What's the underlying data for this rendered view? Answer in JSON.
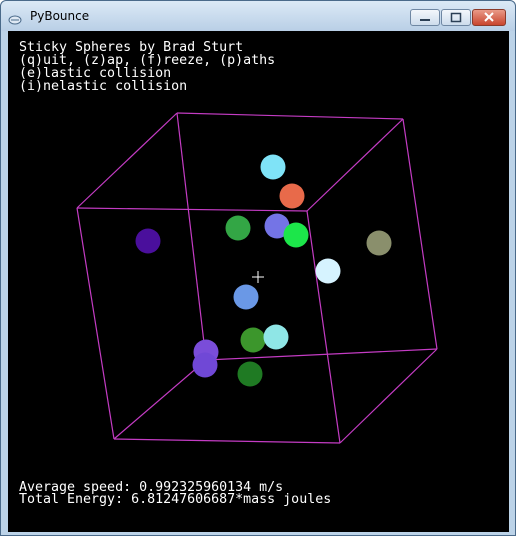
{
  "window": {
    "title": "PyBounce",
    "minimize_icon": "minimize-icon",
    "maximize_icon": "maximize-icon",
    "close_icon": "close-icon"
  },
  "header": {
    "title_line": "Sticky Spheres by Brad Sturt",
    "controls_line": "(q)uit, (z)ap, (f)reeze, (p)aths",
    "elastic_line": "(e)lastic collision",
    "inelastic_line": "(i)nelastic collision"
  },
  "footer": {
    "speed_line": "Average speed: 0.992325960134 m/s",
    "energy_line": "Total Energy: 6.81247606687*mass joules"
  },
  "colors": {
    "background": "#000000",
    "box_edges": "#c43cc4",
    "text": "#ffffff",
    "crosshair": "#ffffff"
  },
  "spheres": [
    {
      "color": "#7fe3f7"
    },
    {
      "color": "#e86a4a"
    },
    {
      "color": "#4a0f9c"
    },
    {
      "color": "#33a645"
    },
    {
      "color": "#7474e6"
    },
    {
      "color": "#1ce64a"
    },
    {
      "color": "#8a8f6c"
    },
    {
      "color": "#d6f3ff"
    },
    {
      "color": "#6a98e6"
    },
    {
      "color": "#3c962c"
    },
    {
      "color": "#8fe6e6"
    },
    {
      "color": "#7a4dd9"
    },
    {
      "color": "#7048d6"
    },
    {
      "color": "#1f7a23"
    }
  ]
}
